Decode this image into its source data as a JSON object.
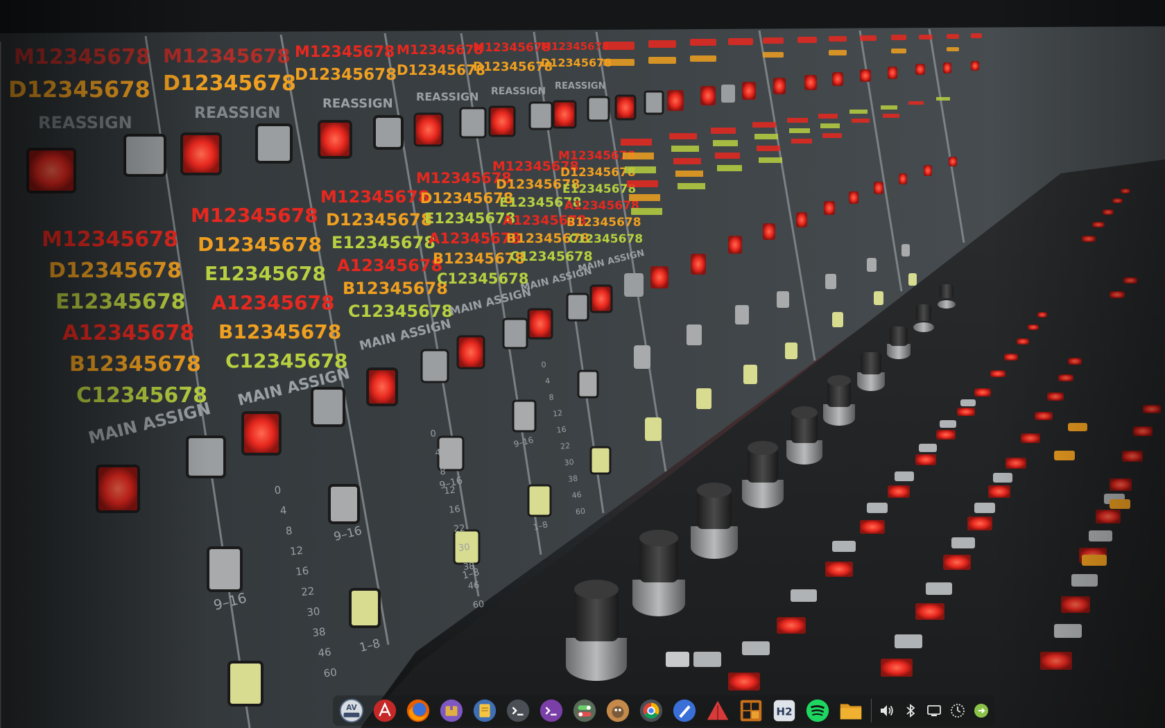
{
  "desktop": {
    "wallpaper": "mixing-console-photo",
    "accent_colors": {
      "led_red": "#e8281f",
      "led_orange": "#f0a020",
      "led_yellow": "#d8d040",
      "led_green": "#a8d040",
      "panel_gray": "#3a3f43"
    },
    "console_labels": {
      "reassign": "REASSIGN",
      "main_assign": "MAIN ASSIGN",
      "digits": "12345678",
      "row_letters": [
        "M",
        "D",
        "E",
        "A",
        "B",
        "C"
      ],
      "fader_scale": [
        "0",
        "4",
        "8",
        "12",
        "16",
        "22",
        "30",
        "38",
        "46",
        "60"
      ],
      "fader_group_high": "9-16",
      "fader_group_low": "1-8"
    }
  },
  "dock": {
    "apps": [
      {
        "name": "av-linux-menu-icon",
        "tooltip": "AV Linux"
      },
      {
        "name": "pdf-reader-icon",
        "tooltip": "PDF Reader"
      },
      {
        "name": "firefox-icon",
        "tooltip": "Firefox"
      },
      {
        "name": "archive-manager-icon",
        "tooltip": "Archive Manager"
      },
      {
        "name": "notes-icon",
        "tooltip": "Notes"
      },
      {
        "name": "terminal-icon",
        "tooltip": "Terminal"
      },
      {
        "name": "root-terminal-icon",
        "tooltip": "Root Terminal"
      },
      {
        "name": "settings-toggle-icon",
        "tooltip": "Settings"
      },
      {
        "name": "gimp-icon",
        "tooltip": "GIMP"
      },
      {
        "name": "chromium-icon",
        "tooltip": "Chromium"
      },
      {
        "name": "pen-tool-icon",
        "tooltip": "Inkscape"
      },
      {
        "name": "triangle-app-icon",
        "tooltip": "App"
      },
      {
        "name": "tiles-app-icon",
        "tooltip": "App"
      },
      {
        "name": "h2-app-icon",
        "tooltip": "Hydrogen"
      },
      {
        "name": "spotify-icon",
        "tooltip": "Spotify"
      },
      {
        "name": "file-manager-icon",
        "tooltip": "Files"
      }
    ],
    "tray": [
      {
        "name": "volume-icon"
      },
      {
        "name": "bluetooth-icon"
      },
      {
        "name": "display-icon"
      },
      {
        "name": "clock-icon"
      },
      {
        "name": "logout-power-icon"
      }
    ]
  }
}
